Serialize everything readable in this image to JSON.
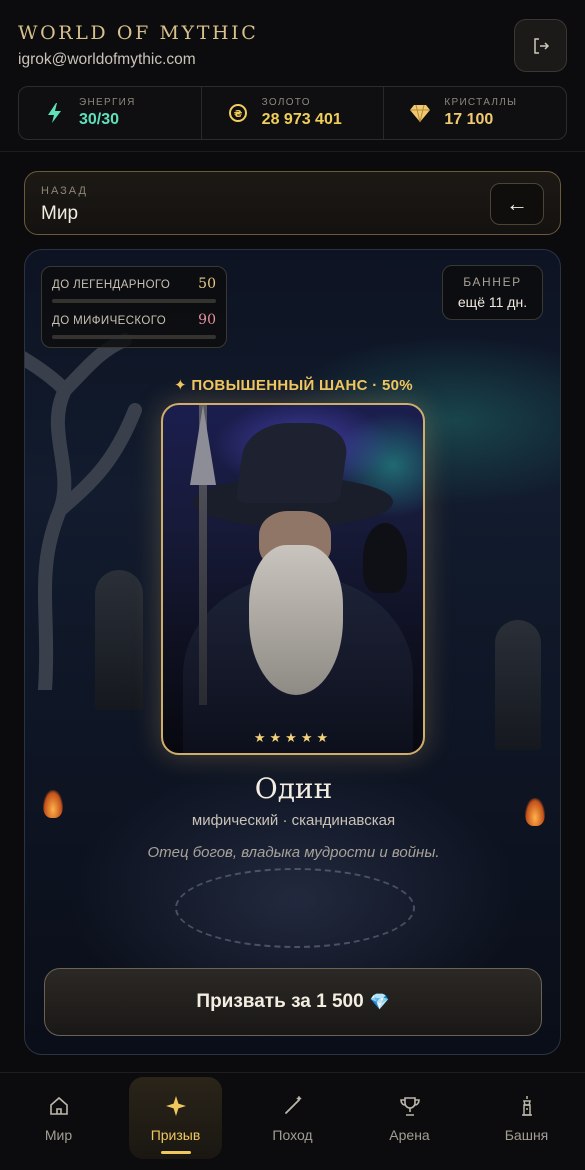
{
  "header": {
    "brand": "WORLD OF MYTHIC",
    "email": "igrok@worldofmythic.com"
  },
  "stats": {
    "energy": {
      "label": "ЭНЕРГИЯ",
      "value": "30/30"
    },
    "gold": {
      "label": "ЗОЛОТО",
      "value": "28 973 401"
    },
    "crystals": {
      "label": "КРИСТАЛЛЫ",
      "value": "17 100"
    }
  },
  "back": {
    "label": "НАЗАД",
    "value": "Мир",
    "arrow": "←"
  },
  "pity": {
    "legendary": {
      "label": "ДО ЛЕГЕНДАРНОГО",
      "value": "50",
      "progress": 0.0
    },
    "mythic": {
      "label": "ДО МИФИЧЕСКОГО",
      "value": "90",
      "progress": 0.0
    }
  },
  "banner": {
    "label": "БАННЕР",
    "value": "ещё 11 дн."
  },
  "chance": "✦ ПОВЫШЕННЫЙ ШАНС · 50%",
  "hero": {
    "stars": "★★★★★",
    "name": "Один",
    "subtitle": "мифический · скандинавская",
    "description": "Отец богов, владыка мудрости и войны."
  },
  "summon": {
    "label": "Призвать за 1 500",
    "icon": "💎"
  },
  "nav": {
    "items": [
      {
        "label": "Мир",
        "icon": "home-icon"
      },
      {
        "label": "Призыв",
        "icon": "sparkle-icon"
      },
      {
        "label": "Поход",
        "icon": "wand-icon"
      },
      {
        "label": "Арена",
        "icon": "trophy-icon"
      },
      {
        "label": "Башня",
        "icon": "tower-icon"
      }
    ],
    "active": "Призыв"
  },
  "colors": {
    "accent": "#f0c65e",
    "energy": "#5fe0b8",
    "legendary": "#e6c887",
    "mythic": "#e8909f"
  }
}
